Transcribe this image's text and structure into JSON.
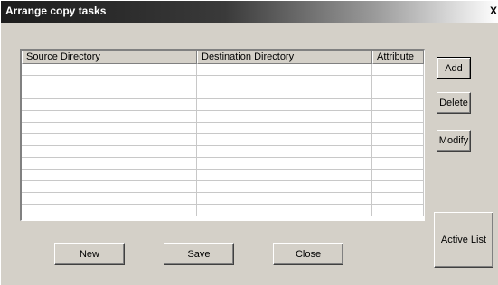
{
  "window": {
    "title": "Arrange copy tasks",
    "close_glyph": "X"
  },
  "grid": {
    "columns": [
      "Source Directory",
      "Destination Directory",
      "Attribute"
    ],
    "rows": [
      [
        "",
        "",
        ""
      ],
      [
        "",
        "",
        ""
      ],
      [
        "",
        "",
        ""
      ],
      [
        "",
        "",
        ""
      ],
      [
        "",
        "",
        ""
      ],
      [
        "",
        "",
        ""
      ],
      [
        "",
        "",
        ""
      ],
      [
        "",
        "",
        ""
      ],
      [
        "",
        "",
        ""
      ],
      [
        "",
        "",
        ""
      ],
      [
        "",
        "",
        ""
      ],
      [
        "",
        "",
        ""
      ],
      [
        "",
        "",
        ""
      ]
    ]
  },
  "side_buttons": {
    "add": "Add",
    "delete": "Delete",
    "modify": "Modify",
    "active_list": "Active List"
  },
  "bottom_buttons": {
    "new": "New",
    "save": "Save",
    "close": "Close"
  },
  "colors": {
    "face": "#d4d0c8",
    "title_start": "#1c1c1c",
    "title_end": "#ffffff"
  }
}
